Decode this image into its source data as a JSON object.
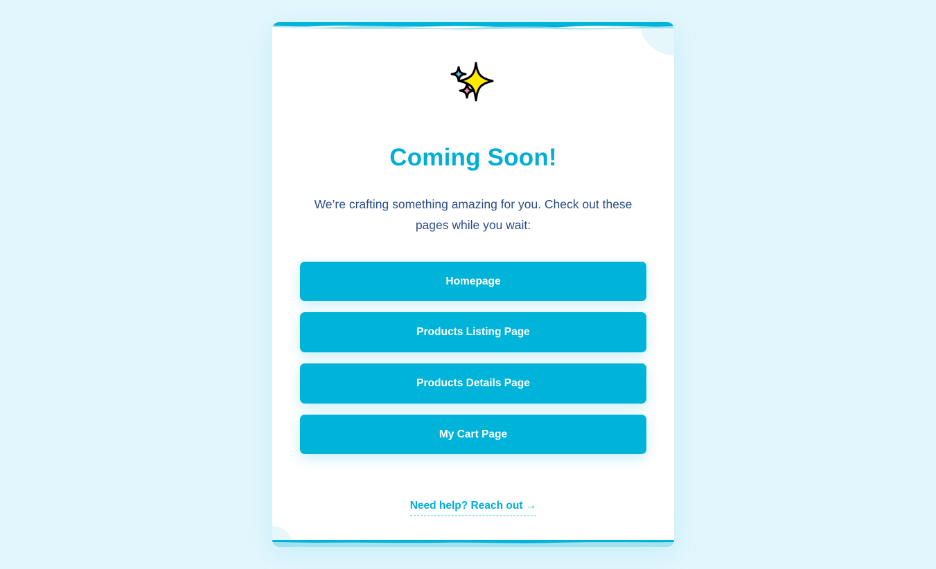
{
  "colors": {
    "page_background": "#e2f6fd",
    "accent": "#00b3d8",
    "title": "#00aed6",
    "subtitle": "#2a4c86",
    "card": "#ffffff"
  },
  "icon": "sparkles-icon",
  "title": "Coming Soon!",
  "subtitle": "We’re crafting something amazing for you. Check out these pages while you wait:",
  "buttons": [
    {
      "label": "Homepage"
    },
    {
      "label": "Products Listing Page"
    },
    {
      "label": "Products Details Page"
    },
    {
      "label": "My Cart Page"
    }
  ],
  "help_link": "Need help? Reach out →"
}
